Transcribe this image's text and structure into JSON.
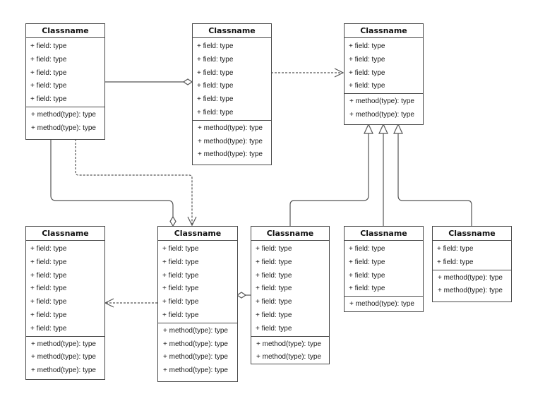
{
  "diagram": {
    "type": "UML class diagram",
    "classes": [
      {
        "id": "c1",
        "name": "Classname",
        "fields": [
          "+ field: type",
          "+ field: type",
          "+ field: type",
          "+ field: type",
          "+ field: type"
        ],
        "methods": [
          "+ method(type): type",
          "+ method(type): type"
        ]
      },
      {
        "id": "c2",
        "name": "Classname",
        "fields": [
          "+ field: type",
          "+ field: type",
          "+ field: type",
          "+ field: type",
          "+ field: type",
          "+ field: type"
        ],
        "methods": [
          "+ method(type): type",
          "+ method(type): type",
          "+ method(type): type"
        ]
      },
      {
        "id": "c3",
        "name": "Classname",
        "fields": [
          "+ field: type",
          "+ field: type",
          "+ field: type",
          "+ field: type"
        ],
        "methods": [
          "+ method(type): type",
          "+ method(type): type"
        ]
      },
      {
        "id": "c4",
        "name": "Classname",
        "fields": [
          "+ field: type",
          "+ field: type",
          "+ field: type",
          "+ field: type",
          "+ field: type",
          "+ field: type",
          "+ field: type"
        ],
        "methods": [
          "+ method(type): type",
          "+ method(type): type",
          "+ method(type): type"
        ]
      },
      {
        "id": "c5",
        "name": "Classname",
        "fields": [
          "+ field: type",
          "+ field: type",
          "+ field: type",
          "+ field: type",
          "+ field: type",
          "+ field: type"
        ],
        "methods": [
          "+ method(type): type",
          "+ method(type): type",
          "+ method(type): type",
          "+ method(type): type"
        ]
      },
      {
        "id": "c6",
        "name": "Classname",
        "fields": [
          "+ field: type",
          "+ field: type",
          "+ field: type",
          "+ field: type",
          "+ field: type",
          "+ field: type",
          "+ field: type"
        ],
        "methods": [
          "+ method(type): type",
          "+ method(type): type"
        ]
      },
      {
        "id": "c7",
        "name": "Classname",
        "fields": [
          "+ field: type",
          "+ field: type",
          "+ field: type",
          "+ field: type"
        ],
        "methods": [
          "+ method(type): type"
        ]
      },
      {
        "id": "c8",
        "name": "Classname",
        "fields": [
          "+ field: type",
          "+ field: type"
        ],
        "methods": [
          "+ method(type): type",
          "+ method(type): type"
        ]
      }
    ],
    "relationships": [
      {
        "kind": "aggregation",
        "from": "c1",
        "to": "c2"
      },
      {
        "kind": "dependency",
        "from": "c2",
        "to": "c3"
      },
      {
        "kind": "aggregation",
        "from": "c1",
        "to": "c5"
      },
      {
        "kind": "dependency",
        "from": "c1",
        "to": "c5"
      },
      {
        "kind": "dependency",
        "from": "c5",
        "to": "c4"
      },
      {
        "kind": "aggregation",
        "from": "c6",
        "to": "c5"
      },
      {
        "kind": "generalization",
        "from": "c6",
        "to": "c3"
      },
      {
        "kind": "generalization",
        "from": "c7",
        "to": "c3"
      },
      {
        "kind": "generalization",
        "from": "c8",
        "to": "c3"
      }
    ]
  }
}
